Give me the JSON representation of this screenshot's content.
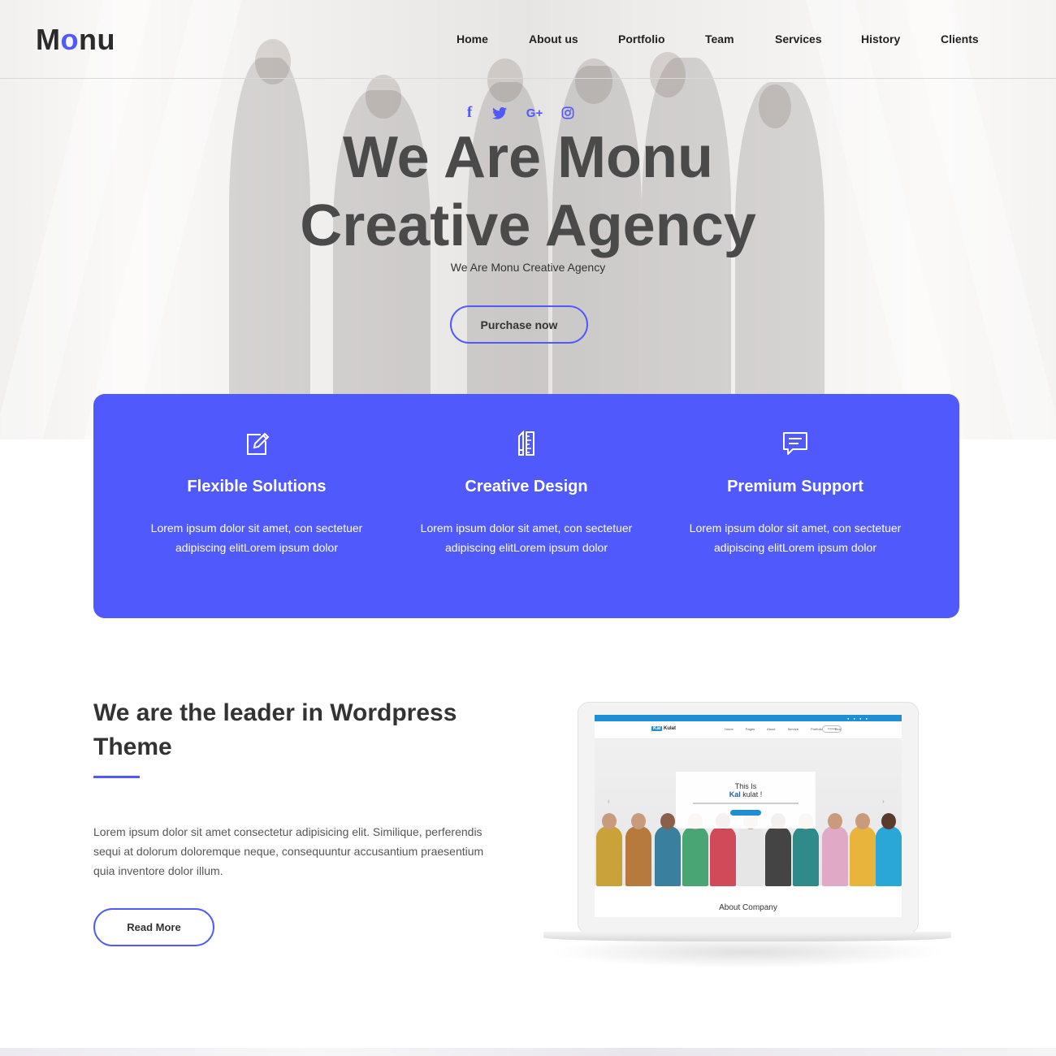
{
  "brand": {
    "logo_prefix": "M",
    "logo_accent": "o",
    "logo_suffix": "nu",
    "accent_color": "#5059fc"
  },
  "nav": {
    "items": [
      {
        "label": "Home"
      },
      {
        "label": "About us"
      },
      {
        "label": "Portfolio"
      },
      {
        "label": "Team"
      },
      {
        "label": "Services"
      },
      {
        "label": "History"
      },
      {
        "label": "Clients"
      }
    ]
  },
  "social": {
    "facebook": "f",
    "twitter": "twitter-icon",
    "googleplus": "G+",
    "instagram": "instagram-icon"
  },
  "hero": {
    "title_line1": "We Are Monu",
    "title_line2": "Creative Agency",
    "subtitle": "We Are Monu Creative Agency",
    "button_label": "Purchase now"
  },
  "features": [
    {
      "icon": "edit-icon",
      "title": "Flexible Solutions",
      "line1": "Lorem ipsum dolor sit amet, con sectetuer",
      "line2": "adipiscing elitLorem ipsum dolor"
    },
    {
      "icon": "design-tools-icon",
      "title": "Creative Design",
      "line1": "Lorem ipsum dolor sit amet, con sectetuer",
      "line2": "adipiscing elitLorem ipsum dolor"
    },
    {
      "icon": "chat-icon",
      "title": "Premium Support",
      "line1": "Lorem ipsum dolor sit amet, con sectetuer",
      "line2": "adipiscing elitLorem ipsum dolor"
    }
  ],
  "about": {
    "title_line1": "We are the leader in Wordpress",
    "title_line2": "Theme",
    "text_line1": "Lorem ipsum dolor sit amet consectetur adipisicing elit. Similique, perferendis",
    "text_line2": "sequi at dolorum doloremque neque, consequuntur accusantium praesentium",
    "text_line3": "quia inventore dolor illum.",
    "button_label": "Read More"
  },
  "laptop_screen": {
    "logo_badge": "Kal",
    "logo_text": "Kulat",
    "menu": [
      "Home",
      "Pages",
      "About",
      "Service",
      "Portfolio",
      "Blog"
    ],
    "contact": "Contact",
    "card_small": "This Is",
    "card_big_bold": "Kal",
    "card_big_rest": "kulat !",
    "prev_arrow": "‹",
    "next_arrow": "›",
    "section_title": "About Company"
  }
}
